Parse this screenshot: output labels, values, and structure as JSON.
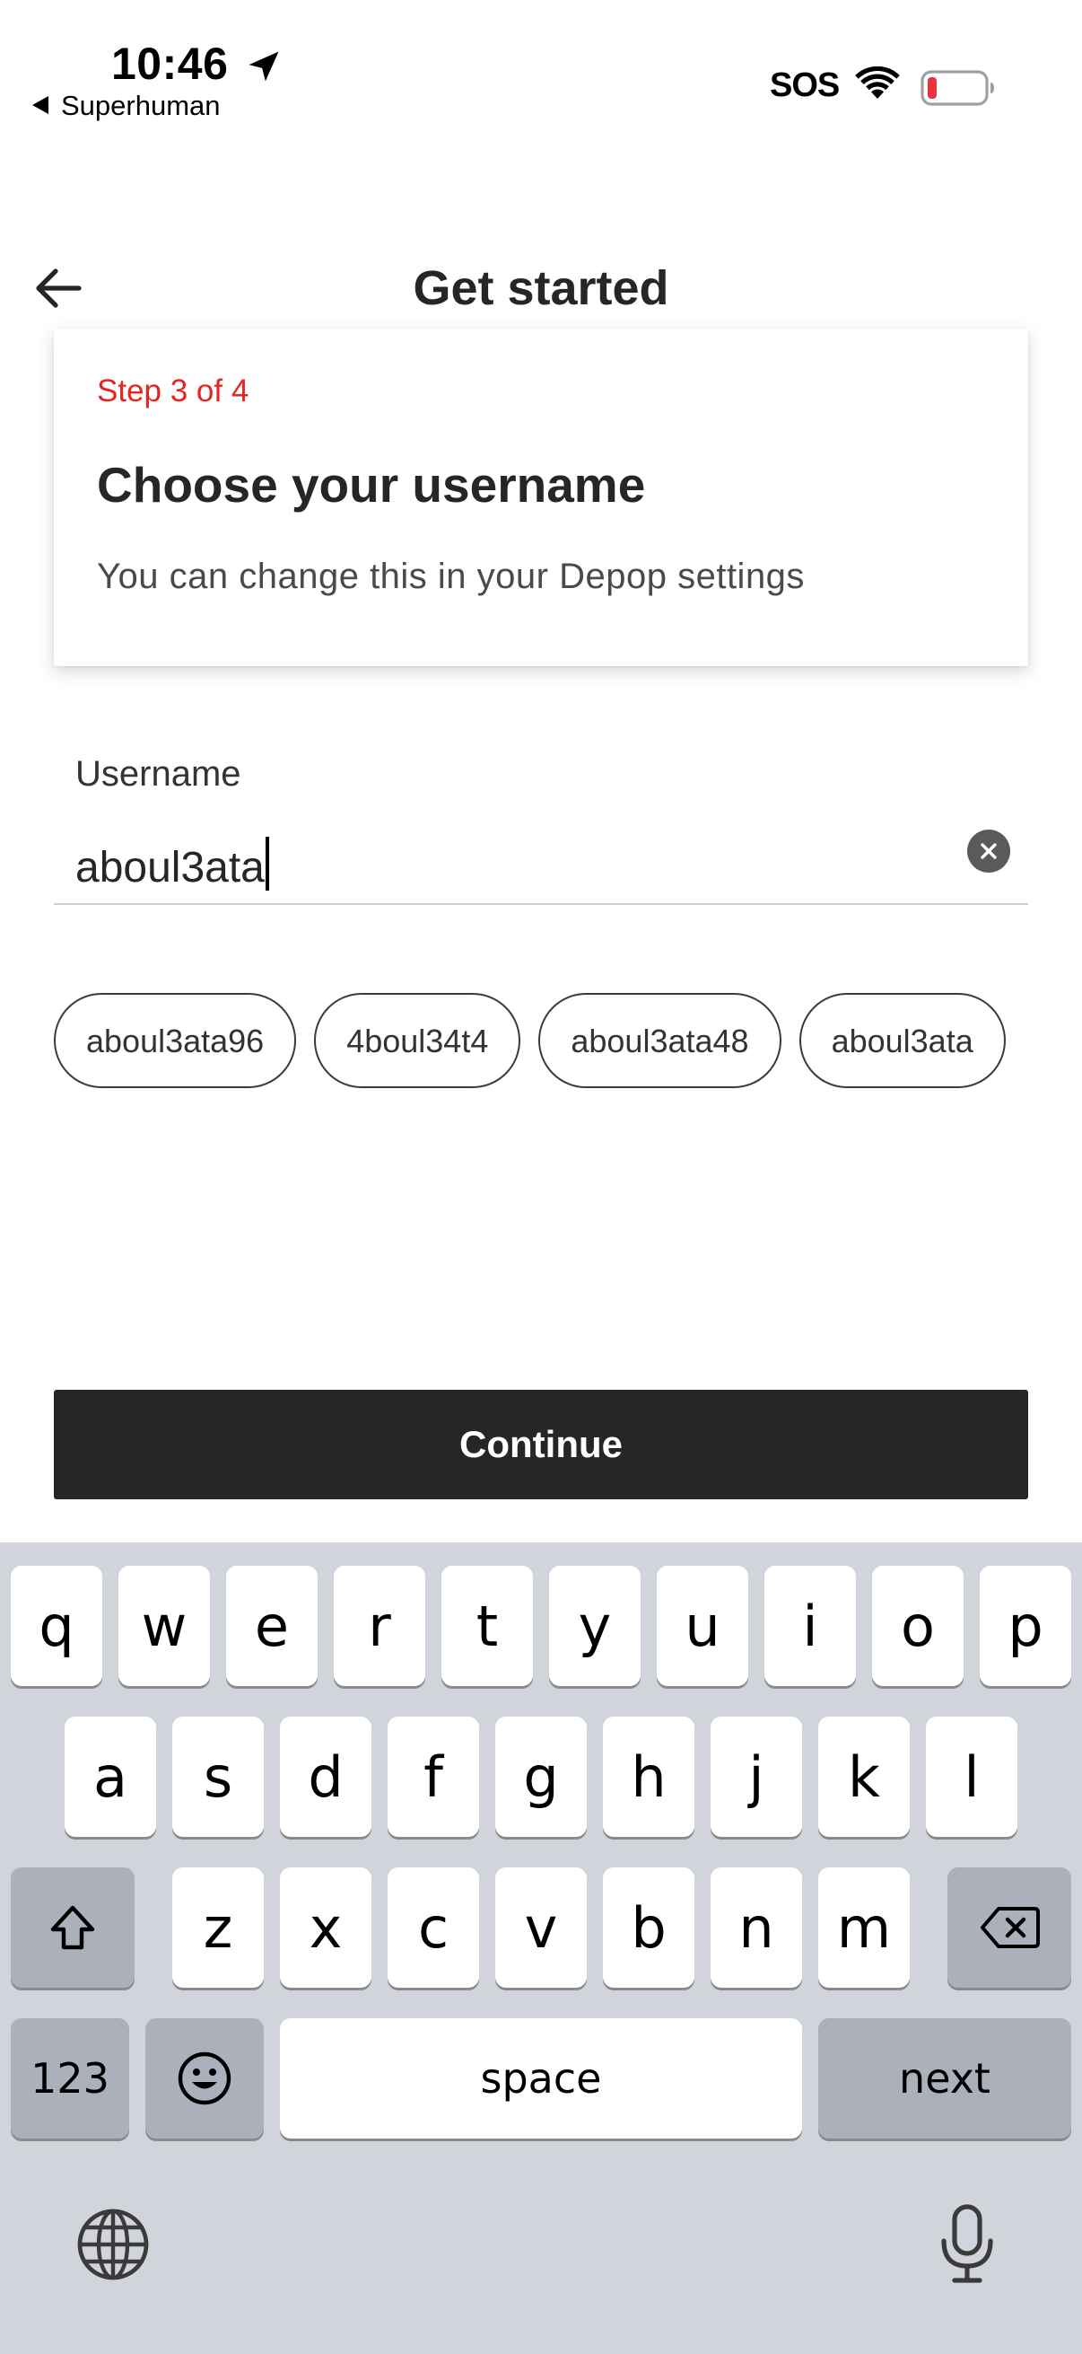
{
  "status": {
    "time": "10:46",
    "back_app": "Superhuman",
    "sos": "SOS"
  },
  "nav": {
    "title": "Get started"
  },
  "card": {
    "step": "Step 3 of 4",
    "title": "Choose your username",
    "subtitle": "You can change this in your Depop settings"
  },
  "field": {
    "label": "Username",
    "value": "aboul3ata"
  },
  "suggestions": [
    "aboul3ata96",
    "4boul34t4",
    "aboul3ata48",
    "aboul3ata"
  ],
  "continue_label": "Continue",
  "keyboard": {
    "row1": [
      "q",
      "w",
      "e",
      "r",
      "t",
      "y",
      "u",
      "i",
      "o",
      "p"
    ],
    "row2": [
      "a",
      "s",
      "d",
      "f",
      "g",
      "h",
      "j",
      "k",
      "l"
    ],
    "row3": [
      "z",
      "x",
      "c",
      "v",
      "b",
      "n",
      "m"
    ],
    "numbers_label": "123",
    "space_label": "space",
    "next_label": "next"
  },
  "colors": {
    "accent": "#e3261f",
    "button": "#262626",
    "keyboard_bg": "#d1d4db"
  }
}
